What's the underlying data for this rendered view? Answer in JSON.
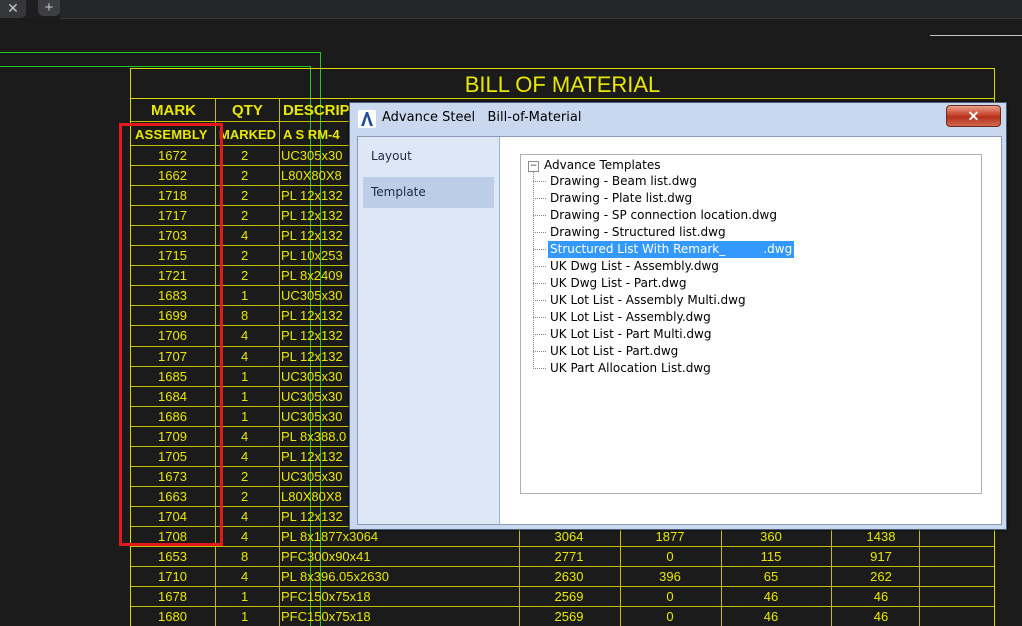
{
  "tabs": {
    "close_glyph": "✕",
    "add_glyph": "+"
  },
  "bom": {
    "title": "BILL OF MATERIAL",
    "headers": [
      "MARK",
      "QTY",
      "DESCRIP"
    ],
    "subheaders": [
      "ASSEMBLY",
      "MARKED",
      "A S RM-4"
    ],
    "rows": [
      {
        "mark": "1672",
        "qty": "2",
        "desc": "UC305x30"
      },
      {
        "mark": "1662",
        "qty": "2",
        "desc": "L80X80X8"
      },
      {
        "mark": "1718",
        "qty": "2",
        "desc": "PL 12x132"
      },
      {
        "mark": "1717",
        "qty": "2",
        "desc": "PL 12x132"
      },
      {
        "mark": "1703",
        "qty": "4",
        "desc": "PL 12x132"
      },
      {
        "mark": "1715",
        "qty": "2",
        "desc": "PL 10x253"
      },
      {
        "mark": "1721",
        "qty": "2",
        "desc": "PL 8x2409"
      },
      {
        "mark": "1683",
        "qty": "1",
        "desc": "UC305x30"
      },
      {
        "mark": "1699",
        "qty": "8",
        "desc": "PL 12x132"
      },
      {
        "mark": "1706",
        "qty": "4",
        "desc": "PL 12x132"
      },
      {
        "mark": "1707",
        "qty": "4",
        "desc": "PL 12x132"
      },
      {
        "mark": "1685",
        "qty": "1",
        "desc": "UC305x30"
      },
      {
        "mark": "1684",
        "qty": "1",
        "desc": "UC305x30"
      },
      {
        "mark": "1686",
        "qty": "1",
        "desc": "UC305x30"
      },
      {
        "mark": "1709",
        "qty": "4",
        "desc": "PL 8x388.0"
      },
      {
        "mark": "1705",
        "qty": "4",
        "desc": "PL 12x132"
      },
      {
        "mark": "1673",
        "qty": "2",
        "desc": "UC305x30"
      },
      {
        "mark": "1663",
        "qty": "2",
        "desc": "L80X80X8"
      },
      {
        "mark": "1704",
        "qty": "4",
        "desc": "PL 12x132"
      }
    ],
    "full_rows": [
      {
        "mark": "1708",
        "qty": "4",
        "desc": "PL 8x1877x3064",
        "c1": "3064",
        "c2": "1877",
        "c3": "360",
        "c4": "1438"
      },
      {
        "mark": "1653",
        "qty": "8",
        "desc": "PFC300x90x41",
        "c1": "2771",
        "c2": "0",
        "c3": "115",
        "c4": "917"
      },
      {
        "mark": "1710",
        "qty": "4",
        "desc": "PL 8x396.05x2630",
        "c1": "2630",
        "c2": "396",
        "c3": "65",
        "c4": "262"
      },
      {
        "mark": "1678",
        "qty": "1",
        "desc": "PFC150x75x18",
        "c1": "2569",
        "c2": "0",
        "c3": "46",
        "c4": "46"
      },
      {
        "mark": "1680",
        "qty": "1",
        "desc": "PFC150x75x18",
        "c1": "2569",
        "c2": "0",
        "c3": "46",
        "c4": "46"
      }
    ]
  },
  "dialog": {
    "title": "Advance Steel   Bill-of-Material",
    "close_glyph": "✕",
    "nav": [
      {
        "label": "Layout",
        "selected": false
      },
      {
        "label": "Template",
        "selected": true
      }
    ],
    "tree": {
      "root_toggle": "−",
      "root_label": "Advance Templates",
      "items": [
        {
          "label": "Drawing - Beam list.dwg",
          "selected": false
        },
        {
          "label": "Drawing - Plate list.dwg",
          "selected": false
        },
        {
          "label": "Drawing - SP connection location.dwg",
          "selected": false
        },
        {
          "label": "Drawing - Structured list.dwg",
          "selected": false
        },
        {
          "label": "Structured List With Remark_          .dwg",
          "selected": true
        },
        {
          "label": "UK Dwg List - Assembly.dwg",
          "selected": false
        },
        {
          "label": "UK Dwg List - Part.dwg",
          "selected": false
        },
        {
          "label": "UK Lot List - Assembly Multi.dwg",
          "selected": false
        },
        {
          "label": "UK Lot List - Assembly.dwg",
          "selected": false
        },
        {
          "label": "UK Lot List - Part Multi.dwg",
          "selected": false
        },
        {
          "label": "UK Lot List - Part.dwg",
          "selected": false
        },
        {
          "label": "UK Part Allocation List.dwg",
          "selected": false
        }
      ]
    }
  },
  "colors": {
    "cad_yellow": "#e8e800",
    "highlight_red": "#e31a1a",
    "selection_blue": "#3399ff"
  }
}
